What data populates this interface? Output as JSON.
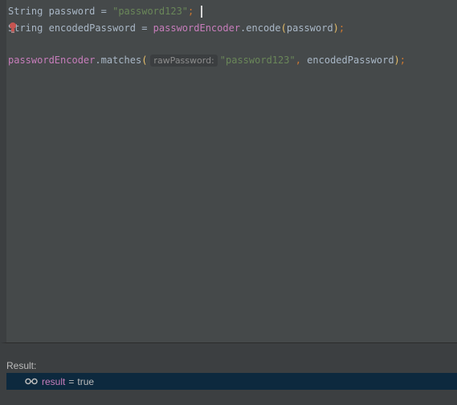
{
  "editor": {
    "line1": {
      "type_kw": "String",
      "var_name": "password",
      "assign": "=",
      "string_literal": "\"password123\"",
      "semicolon": ";"
    },
    "line2": {
      "type_kw": "String",
      "var_name": "encodedPassword",
      "assign": "=",
      "receiver": "passwordEncoder",
      "dot": ".",
      "method": "encode",
      "open_paren": "(",
      "arg": "password",
      "close_paren": ")",
      "semicolon": ";"
    },
    "line3": {
      "receiver": "passwordEncoder",
      "dot": ".",
      "method": "matches",
      "open_paren": "(",
      "param_hint": "rawPassword:",
      "string_literal": "\"password123\"",
      "comma": ",",
      "arg2": "encodedPassword",
      "close_paren": ")",
      "semicolon": ";"
    }
  },
  "result": {
    "label": "Result:",
    "name": "result",
    "equals": "=",
    "value": "true",
    "icon": "watch-glasses-icon"
  },
  "colors": {
    "editor_bg": "#45494a",
    "panel_bg": "#3c3f41",
    "selected_row_bg": "#0d293e",
    "field": "#c77dbb",
    "string": "#6a8759",
    "punct": "#cc7832",
    "text": "#a9b7c6"
  }
}
